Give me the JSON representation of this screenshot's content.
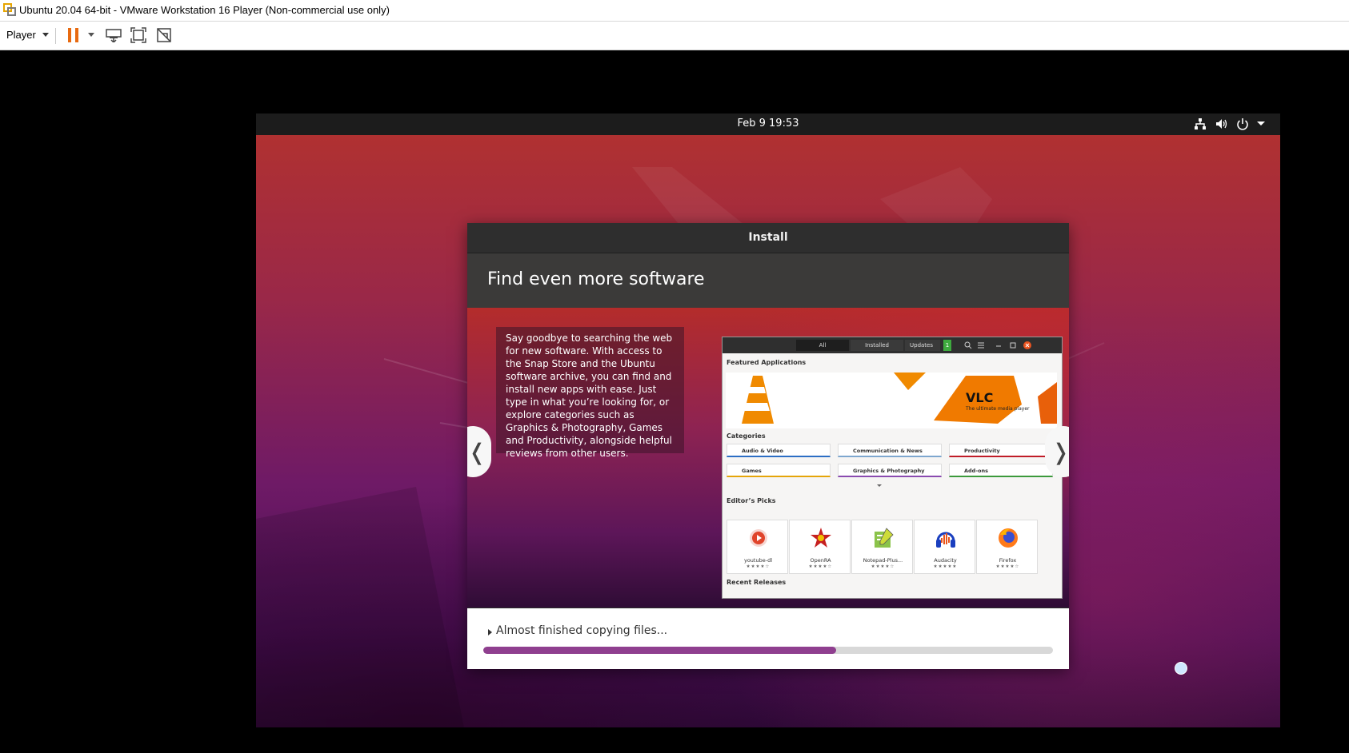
{
  "host": {
    "window_title": "Ubuntu 20.04 64-bit - VMware Workstation 16 Player (Non-commercial use only)",
    "menu_label": "Player"
  },
  "guest": {
    "clock": "Feb 9  19:53"
  },
  "installer": {
    "title": "Install",
    "heading": "Find even more software",
    "description": "Say goodbye to searching the web for new software. With access to the Snap Store and the Ubuntu software archive, you can find and install new apps with ease. Just type in what you’re looking for, or explore categories such as Graphics & Photography, Games and Productivity, alongside helpful reviews from other users.",
    "prev_glyph": "❬",
    "next_glyph": "❭",
    "status": "Almost finished copying files...",
    "progress": 0.62
  },
  "store": {
    "tabs": [
      "All",
      "Installed",
      "Updates"
    ],
    "updates_count": "1",
    "featured_label": "Featured Applications",
    "featured_app": "VLC",
    "featured_tagline": "The ultimate media player",
    "categories_label": "Categories",
    "categories": [
      "Audio & Video",
      "Communication & News",
      "Productivity",
      "Games",
      "Graphics & Photography",
      "Add-ons"
    ],
    "picks_label": "Editor’s Picks",
    "picks": [
      {
        "name": "youtube-dl",
        "stars": "★★★★☆"
      },
      {
        "name": "OpenRA",
        "stars": "★★★★☆"
      },
      {
        "name": "Notepad-Plus...",
        "stars": "★★★★☆"
      },
      {
        "name": "Audacity",
        "stars": "★★★★★"
      },
      {
        "name": "Firefox",
        "stars": "★★★★☆"
      }
    ],
    "recent_label": "Recent Releases"
  },
  "colors": {
    "progress_fill": "#8f3f8f",
    "ubuntu_orange": "#e95420"
  }
}
